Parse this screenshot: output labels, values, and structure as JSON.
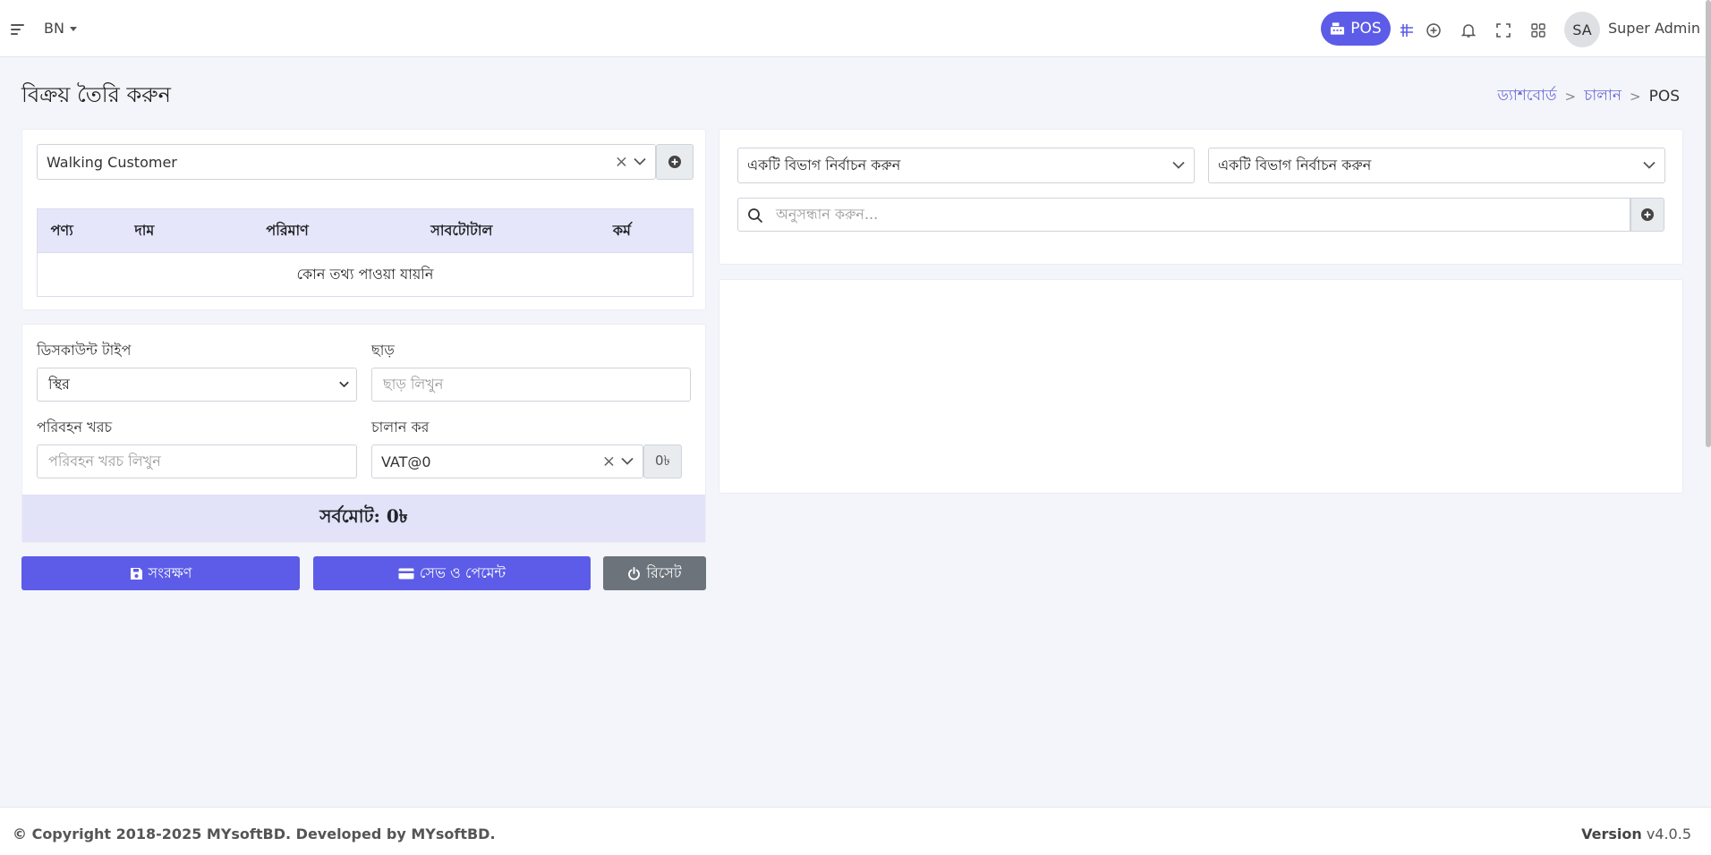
{
  "header": {
    "language": "BN",
    "pos_label": "POS",
    "avatar_initials": "SA",
    "user_name": "Super Admin",
    "icons": [
      "menu-icon",
      "cash-register-icon",
      "calculator-icon",
      "add-circle-icon",
      "bell-icon",
      "fullscreen-icon",
      "apps-icon"
    ]
  },
  "page": {
    "title": "বিক্রয় তৈরি করুন",
    "breadcrumb": [
      "ড্যাশবোর্ড",
      "চালান",
      "POS"
    ],
    "breadcrumb_sep": ">"
  },
  "customer": {
    "selected": "Walking Customer",
    "clear": "×"
  },
  "cart_table": {
    "columns": [
      "পণ্য",
      "দাম",
      "পরিমাণ",
      "সাবটোটাল",
      "কর্ম"
    ],
    "empty_text": "কোন তথ্য পাওয়া যায়নি"
  },
  "form": {
    "discount_type_label": "ডিসকাউন্ট টাইপ",
    "discount_type_value": "স্থির",
    "discount_label": "ছাড়",
    "discount_placeholder": "ছাড় লিখুন",
    "shipping_label": "পরিবহন খরচ",
    "shipping_placeholder": "পরিবহন খরচ লিখুন",
    "tax_label": "চালান কর",
    "tax_value": "VAT@0",
    "tax_amount": "0৳",
    "total_text": "সর্বমোট: 0৳"
  },
  "actions": {
    "save": "সংরক্ষণ",
    "save_payment": "সেভ ও পেমেন্ট",
    "reset": "রিসেট"
  },
  "filters": {
    "category_placeholder": "একটি বিভাগ নির্বাচন করুন",
    "brand_placeholder": "একটি বিভাগ নির্বাচন করুন",
    "search_placeholder": "অনুসন্ধান করুন..."
  },
  "footer": {
    "copyright": "© Copyright 2018-2025 MYsoftBD. Developed by MYsoftBD.",
    "version_label": "Version",
    "version_value": "v4.0.5"
  },
  "colors": {
    "primary": "#5c5ce8",
    "secondary": "#6c737a",
    "total_bg": "#e2e2f9",
    "table_head_bg": "#e6e6fa"
  }
}
